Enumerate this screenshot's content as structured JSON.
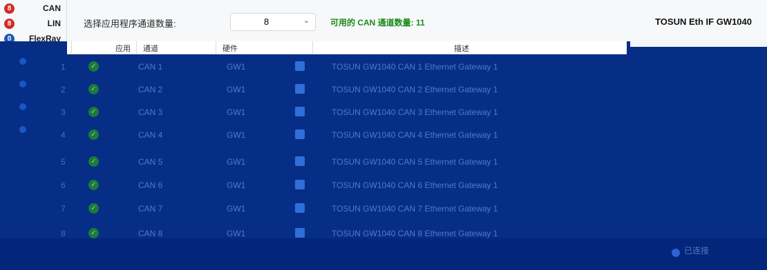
{
  "protocols": [
    {
      "count": "8",
      "label": "CAN",
      "color": "#d32a2a"
    },
    {
      "count": "8",
      "label": "LIN",
      "color": "#d32a2a"
    },
    {
      "count": "0",
      "label": "FlexRay",
      "color": "#1e58b8"
    }
  ],
  "toolbar": {
    "select_label": "选择应用程序通道数量:",
    "select_value": "8",
    "available_text": "可用的 CAN 通道数量: 11",
    "device_name": "TOSUN Eth IF GW1040"
  },
  "table": {
    "headers": [
      "应用",
      "通道",
      "硬件",
      "",
      "描述"
    ],
    "rows": [
      {
        "idx": "1",
        "ch": "CAN 1",
        "hw": "GW1",
        "desc": "TOSUN GW1040 CAN 1 Ethernet Gateway 1"
      },
      {
        "idx": "2",
        "ch": "CAN 2",
        "hw": "GW1",
        "desc": "TOSUN GW1040 CAN 2 Ethernet Gateway 1"
      },
      {
        "idx": "3",
        "ch": "CAN 3",
        "hw": "GW1",
        "desc": "TOSUN GW1040 CAN 3 Ethernet Gateway 1"
      },
      {
        "idx": "4",
        "ch": "CAN 4",
        "hw": "GW1",
        "desc": "TOSUN GW1040 CAN 4 Ethernet Gateway 1"
      },
      {
        "idx": "5",
        "ch": "CAN 5",
        "hw": "GW1",
        "desc": "TOSUN GW1040 CAN 5 Ethernet Gateway 1"
      },
      {
        "idx": "6",
        "ch": "CAN 6",
        "hw": "GW1",
        "desc": "TOSUN GW1040 CAN 6 Ethernet Gateway 1"
      },
      {
        "idx": "7",
        "ch": "CAN 7",
        "hw": "GW1",
        "desc": "TOSUN GW1040 CAN 7 Ethernet Gateway 1"
      },
      {
        "idx": "8",
        "ch": "CAN 8",
        "hw": "GW1",
        "desc": "TOSUN GW1040 CAN 8 Ethernet Gateway 1"
      }
    ]
  },
  "status": {
    "text": "已连接"
  }
}
